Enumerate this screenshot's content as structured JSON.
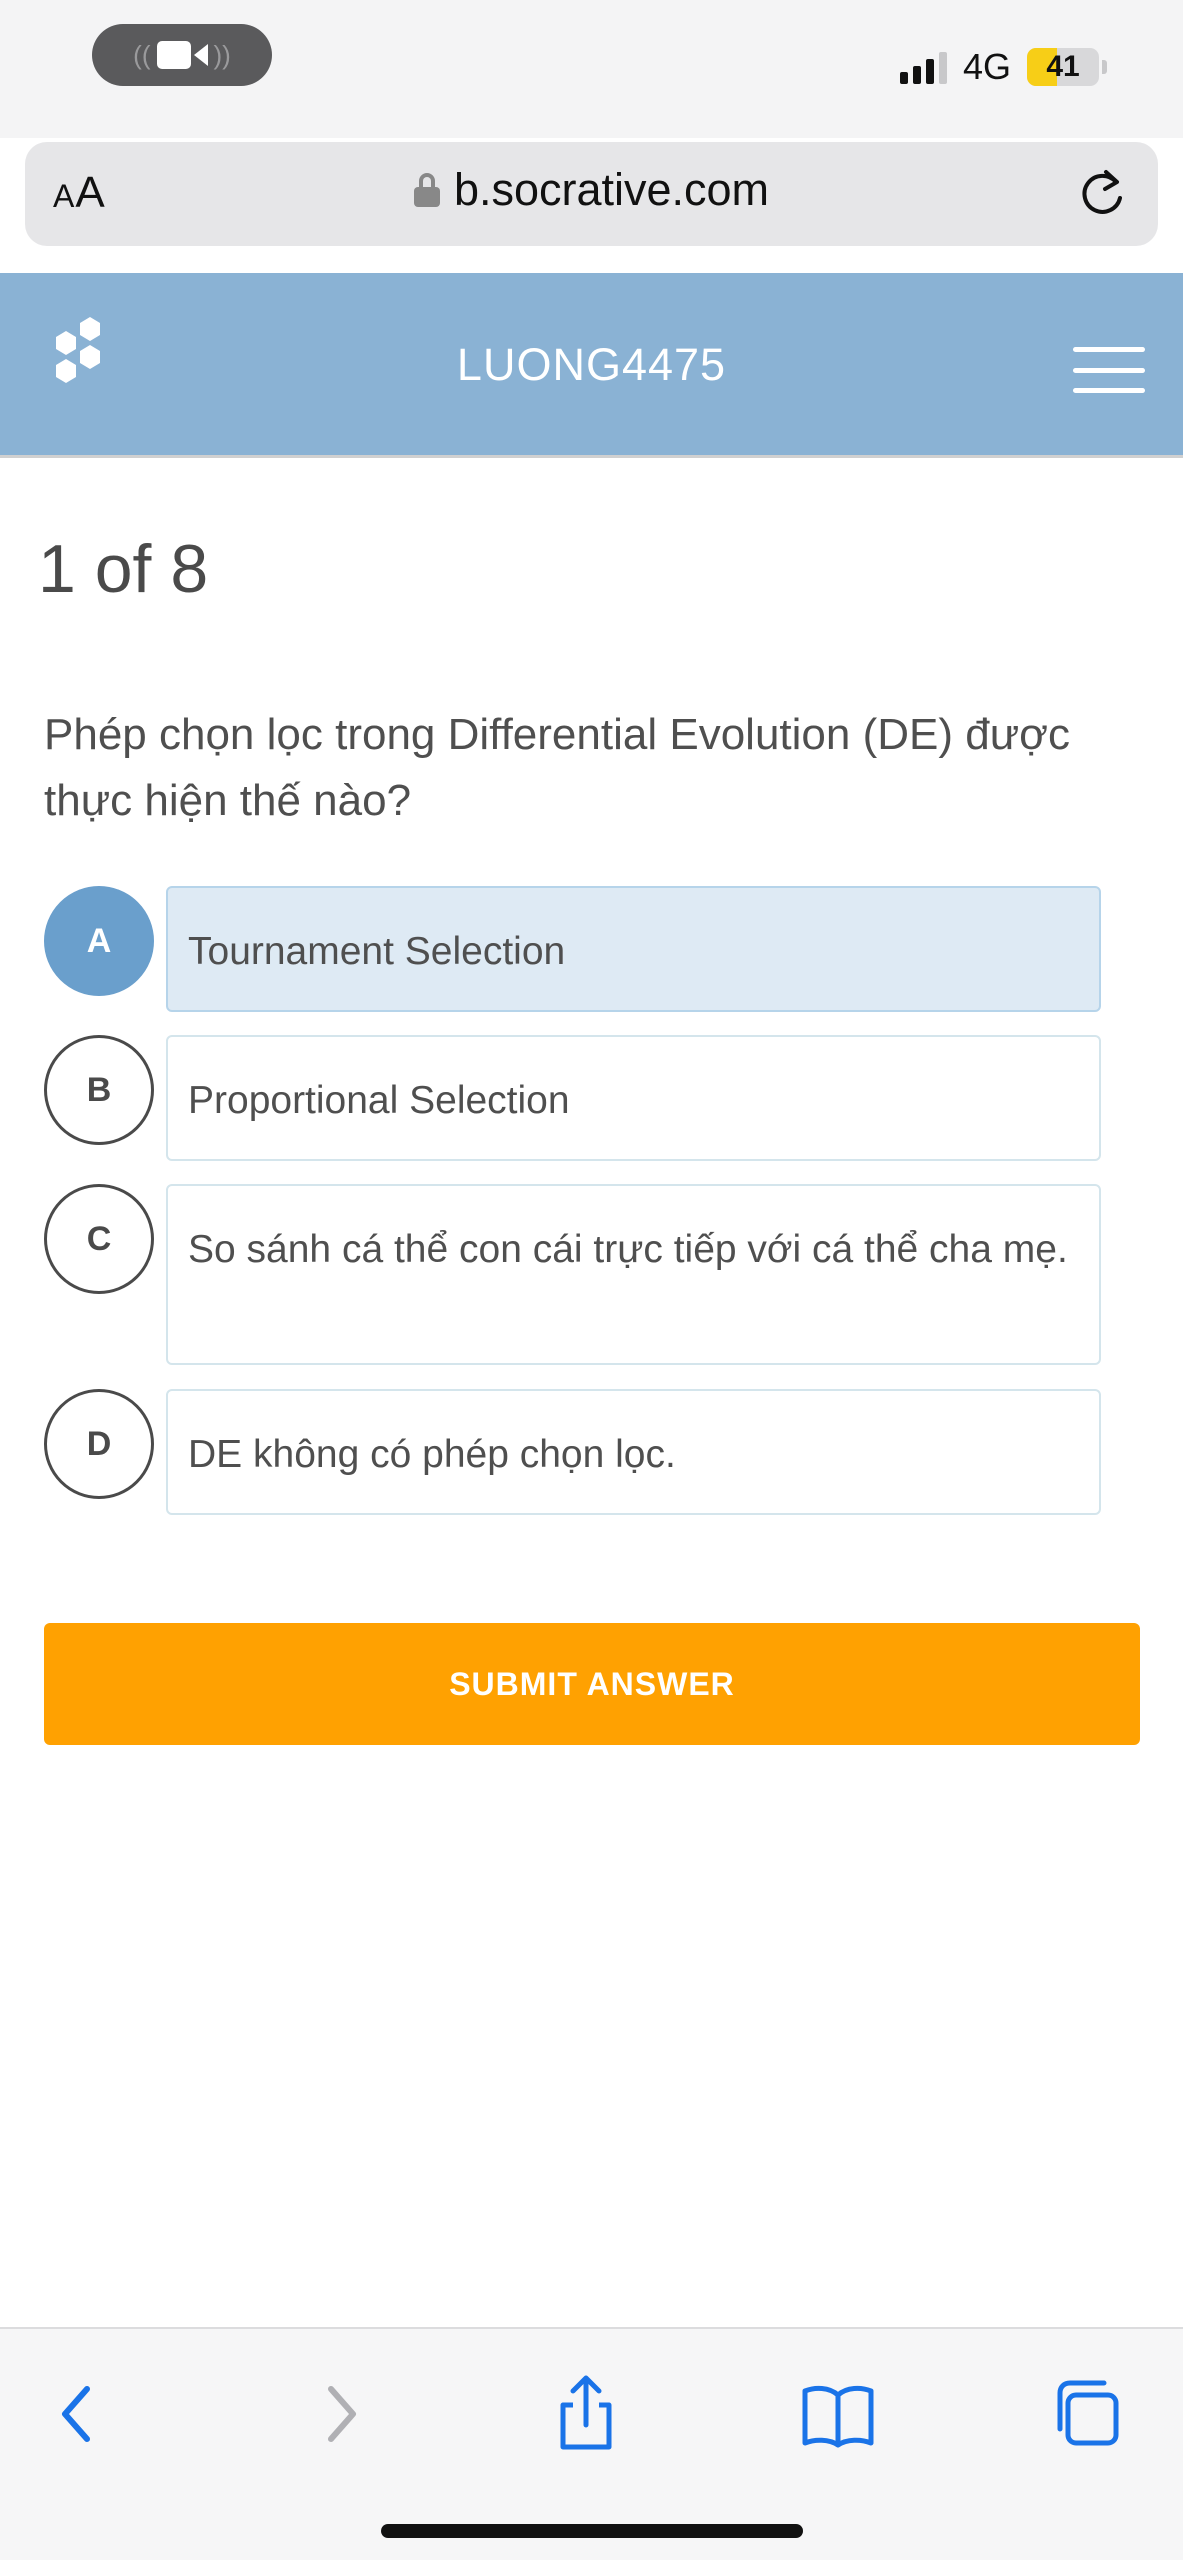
{
  "status_bar": {
    "network": "4G",
    "battery_level": "41",
    "battery_fraction": 0.41,
    "call_indicator_icon": "video-call-icon"
  },
  "browser": {
    "text_size_button": "AA",
    "url": "b.socrative.com",
    "lock_icon": "lock-icon",
    "reload_icon": "reload-icon"
  },
  "header": {
    "room_name": "LUONG4475",
    "logo_icon": "socrative-logo-icon",
    "menu_icon": "hamburger-menu-icon",
    "background": "#8ab2d4"
  },
  "quiz": {
    "progress": "1 of 8",
    "question": "Phép chọn lọc trong Differential Evolution (DE) được thực hiện thế nào?",
    "options": [
      {
        "letter": "A",
        "text": "Tournament Selection",
        "selected": true
      },
      {
        "letter": "B",
        "text": "Proportional Selection",
        "selected": false
      },
      {
        "letter": "C",
        "text": "So sánh cá thể con cái trực tiếp với cá thể cha mẹ.",
        "selected": false
      },
      {
        "letter": "D",
        "text": "DE không có phép chọn lọc.",
        "selected": false
      }
    ],
    "submit_label": "SUBMIT ANSWER",
    "accent_color": "#ffa101",
    "selected_color": "#6a9fcc"
  },
  "toolbar": {
    "icons": [
      "back-icon",
      "forward-icon",
      "share-icon",
      "bookmarks-icon",
      "tabs-icon"
    ]
  }
}
